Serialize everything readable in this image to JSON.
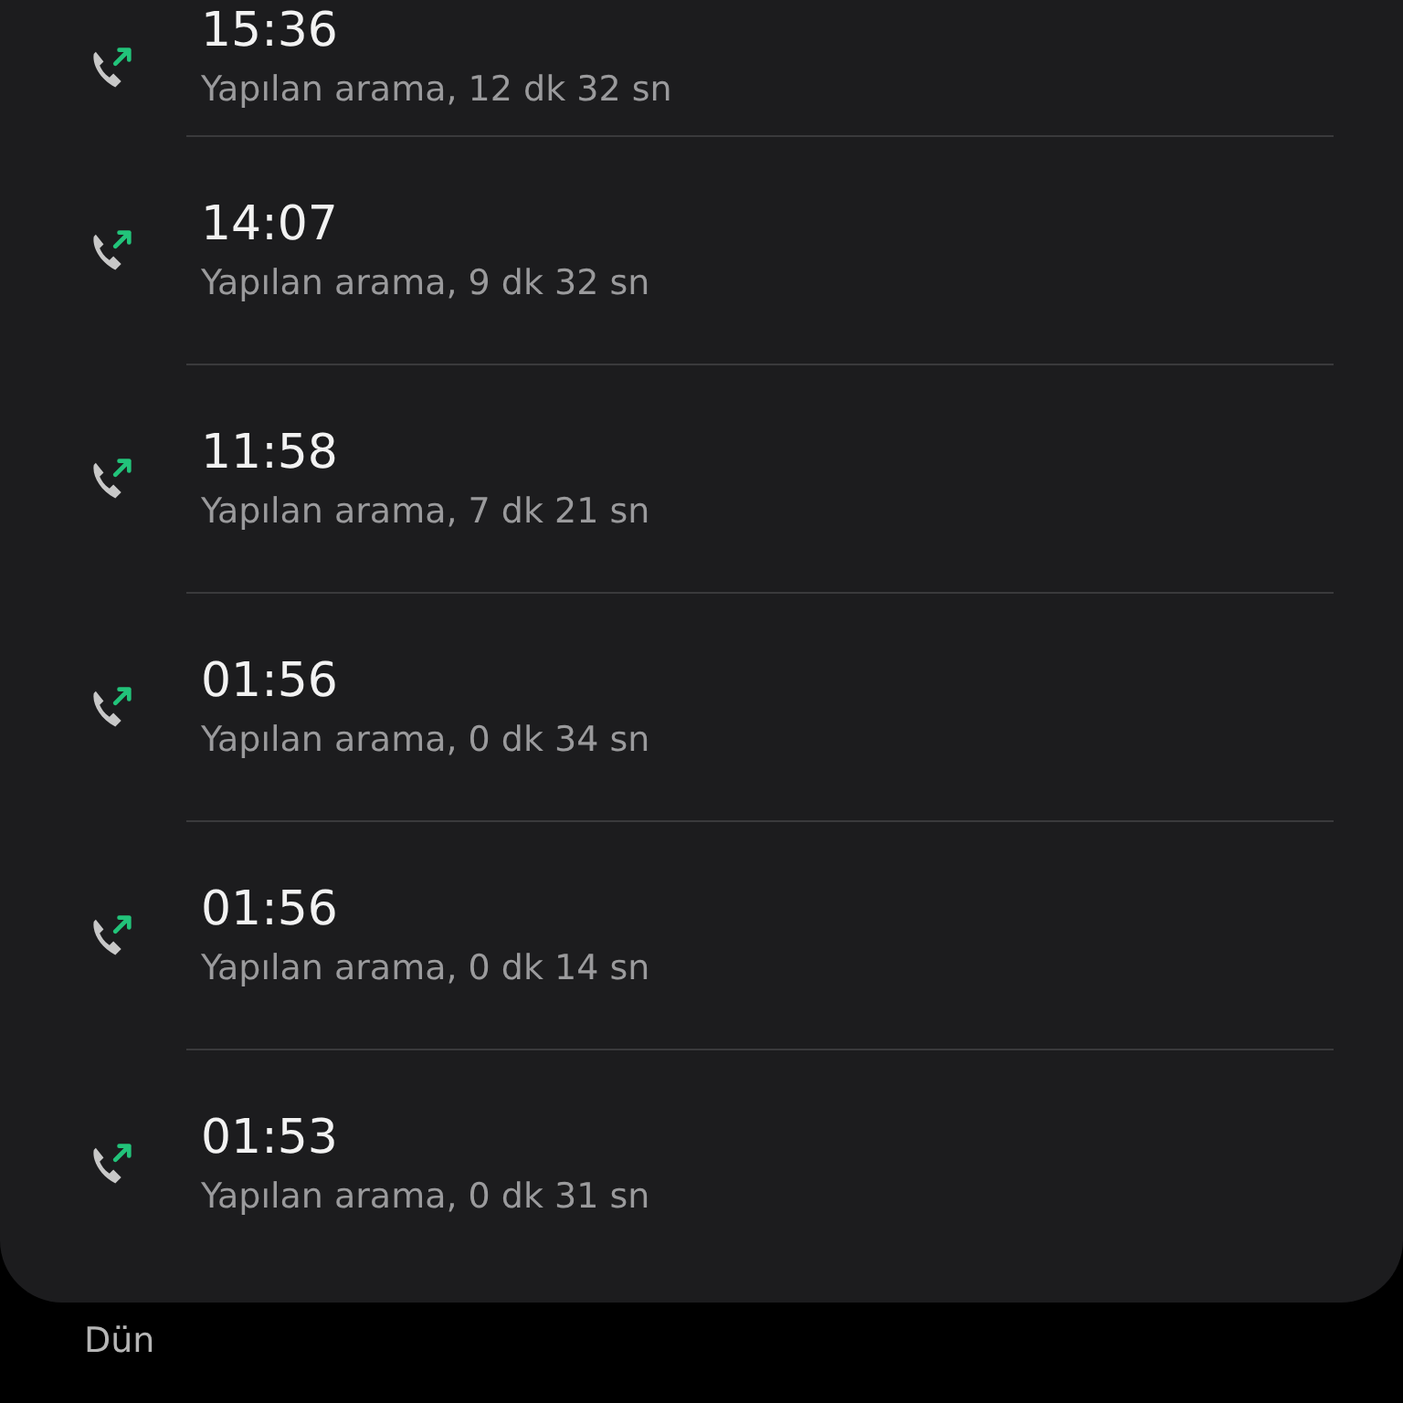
{
  "calls": [
    {
      "time": "15:36",
      "detail": "Yapılan arama, 12 dk 32 sn",
      "kind": "outgoing"
    },
    {
      "time": "14:07",
      "detail": "Yapılan arama, 9 dk 32 sn",
      "kind": "outgoing"
    },
    {
      "time": "11:58",
      "detail": "Yapılan arama, 7 dk 21 sn",
      "kind": "outgoing"
    },
    {
      "time": "01:56",
      "detail": "Yapılan arama, 0 dk 34 sn",
      "kind": "outgoing"
    },
    {
      "time": "01:56",
      "detail": "Yapılan arama, 0 dk 14 sn",
      "kind": "outgoing"
    },
    {
      "time": "01:53",
      "detail": "Yapılan arama, 0 dk 31 sn",
      "kind": "outgoing"
    }
  ],
  "next_section": "Dün"
}
